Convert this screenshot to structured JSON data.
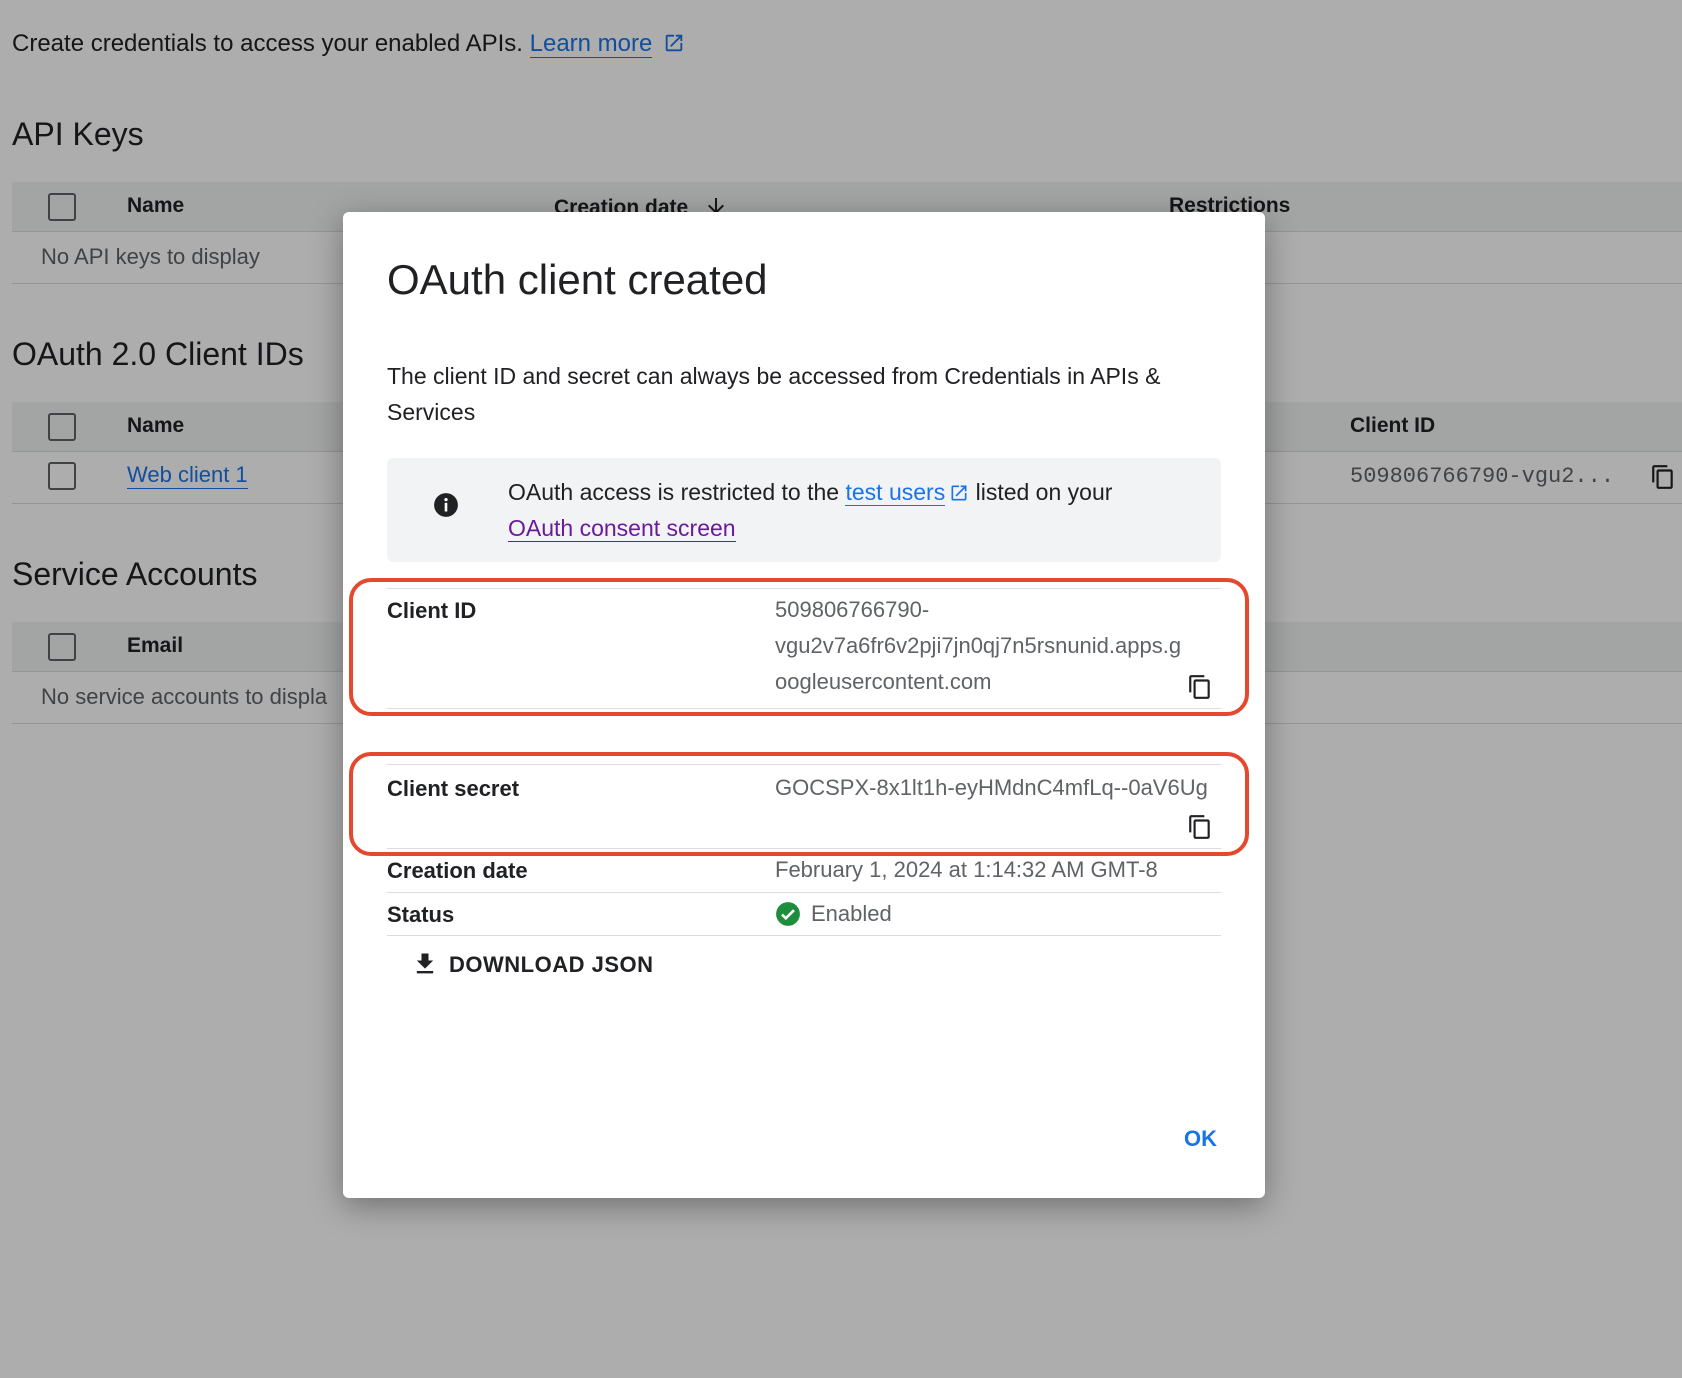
{
  "page": {
    "intro_text": "Create credentials to access your enabled APIs.",
    "learn_more": "Learn more"
  },
  "api_keys": {
    "title": "API Keys",
    "col_name": "Name",
    "col_creation": "Creation date",
    "col_restrictions": "Restrictions",
    "empty": "No API keys to display"
  },
  "oauth": {
    "title": "OAuth 2.0 Client IDs",
    "col_name": "Name",
    "col_client_id": "Client ID",
    "rows": [
      {
        "name": "Web client 1",
        "client_id": "509806766790-vgu2..."
      }
    ]
  },
  "service_accounts": {
    "title": "Service Accounts",
    "col_email": "Email",
    "empty": "No service accounts to displa"
  },
  "dialog": {
    "title": "OAuth client created",
    "description": "The client ID and secret can always be accessed from Credentials in APIs & Services",
    "info_prefix": "OAuth access is restricted to the",
    "info_link1": "test users",
    "info_middle": "listed on your",
    "info_link2": "OAuth consent screen",
    "client_id_label": "Client ID",
    "client_id_line1": "509806766790-",
    "client_id_line2": "vgu2v7a6fr6v2pji7jn0qj7n5rsnunid.apps.g",
    "client_id_line3": "oogleusercontent.com",
    "client_secret_label": "Client secret",
    "client_secret_value": "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",
    "creation_label": "Creation date",
    "creation_value": "February 1, 2024 at 1:14:32 AM GMT-8",
    "status_label": "Status",
    "status_value": "Enabled",
    "download_label": "DOWNLOAD JSON",
    "ok_label": "OK"
  },
  "colors": {
    "link_blue": "#1a73e8",
    "link_purple": "#6a1b9a",
    "highlight_red": "#e4492f",
    "status_green": "#1e8e3e"
  },
  "icons": [
    "external-link-icon",
    "sort-down-arrow-icon",
    "copy-icon",
    "info-icon",
    "check-circle-icon",
    "download-icon"
  ]
}
